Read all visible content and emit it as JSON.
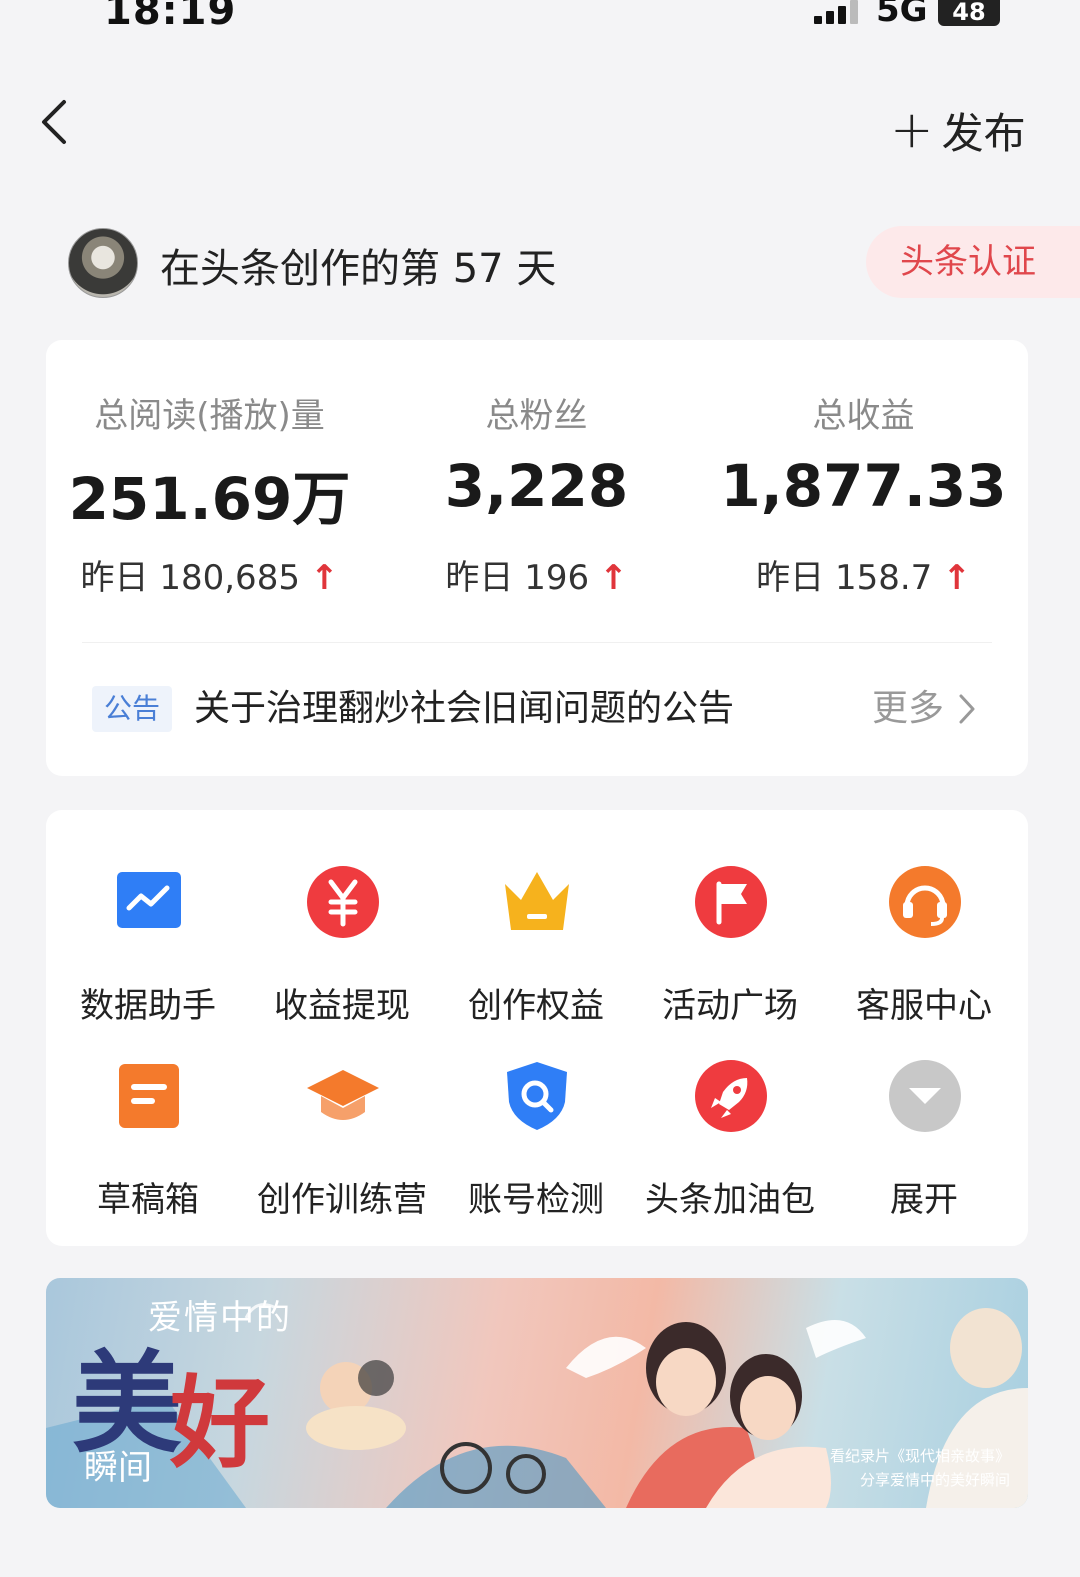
{
  "status_bar": {
    "time": "18:19",
    "network": "5G",
    "battery": "48"
  },
  "nav": {
    "publish_plus": "+",
    "publish_label": "发布"
  },
  "creator": {
    "days_text": "在头条创作的第 57 天",
    "cert_label": "头条认证"
  },
  "stats": [
    {
      "label": "总阅读(播放)量",
      "value": "251.69万",
      "yesterday": "昨日 180,685",
      "trend": "↑"
    },
    {
      "label": "总粉丝",
      "value": "3,228",
      "yesterday": "昨日 196",
      "trend": "↑"
    },
    {
      "label": "总收益",
      "value": "1,877.33",
      "yesterday": "昨日 158.7",
      "trend": "↑"
    }
  ],
  "notice": {
    "tag": "公告",
    "text": "关于治理翻炒社会旧闻问题的公告",
    "more": "更多"
  },
  "tools": [
    {
      "label": "数据助手",
      "icon": "chart-icon",
      "color": "#2f7ef6"
    },
    {
      "label": "收益提现",
      "icon": "yuan-icon",
      "color": "#ef3b3f"
    },
    {
      "label": "创作权益",
      "icon": "crown-icon",
      "color": "#f6b21d"
    },
    {
      "label": "活动广场",
      "icon": "flag-icon",
      "color": "#ef3b3f"
    },
    {
      "label": "客服中心",
      "icon": "headset-icon",
      "color": "#f47a2c"
    },
    {
      "label": "草稿箱",
      "icon": "draft-icon",
      "color": "#f47a2c"
    },
    {
      "label": "创作训练营",
      "icon": "graduation-cap-icon",
      "color": "#f47a2c"
    },
    {
      "label": "账号检测",
      "icon": "search-shield-icon",
      "color": "#2f7ef6"
    },
    {
      "label": "头条加油包",
      "icon": "rocket-icon",
      "color": "#ef3b3f"
    },
    {
      "label": "展开",
      "icon": "chevron-down-icon",
      "color": "#c8c8c8"
    }
  ],
  "banner": {
    "top_text": "爱情中的",
    "big_text_1": "美",
    "big_text_2": "好",
    "small_text": "瞬间",
    "caption_line1": "看纪录片《现代相亲故事》",
    "caption_line2": "分享爱情中的美好瞬间"
  }
}
